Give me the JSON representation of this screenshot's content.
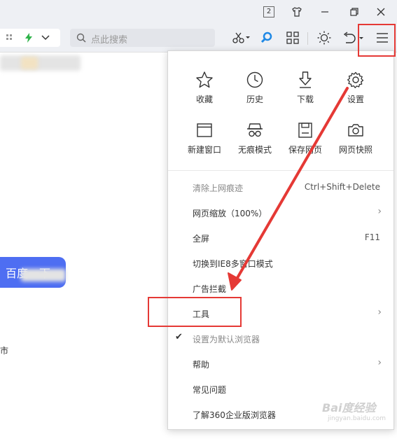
{
  "titlebar": {
    "tab_count": "2"
  },
  "toolbar": {
    "search_placeholder": "点此搜索"
  },
  "page": {
    "search_button": "百度一下",
    "fragment_text": "市"
  },
  "menu": {
    "grid": [
      {
        "label": "收藏",
        "icon": "star-icon"
      },
      {
        "label": "历史",
        "icon": "clock-icon"
      },
      {
        "label": "下载",
        "icon": "download-icon"
      },
      {
        "label": "设置",
        "icon": "gear-icon"
      },
      {
        "label": "新建窗口",
        "icon": "window-icon"
      },
      {
        "label": "无痕模式",
        "icon": "incognito-icon"
      },
      {
        "label": "保存网页",
        "icon": "save-icon"
      },
      {
        "label": "网页快照",
        "icon": "camera-icon"
      }
    ],
    "items": [
      {
        "label": "清除上网痕迹",
        "shortcut": "Ctrl+Shift+Delete"
      },
      {
        "label": "网页缩放（100%）",
        "arrow": "›"
      },
      {
        "label": "全屏",
        "shortcut": "F11"
      },
      {
        "label": "切换到IE8多窗口模式"
      },
      {
        "label": "广告拦截"
      },
      {
        "label": "工具",
        "arrow": "›"
      },
      {
        "label": "设置为默认浏览器",
        "check": "✔"
      },
      {
        "label": "帮助",
        "arrow": "›"
      },
      {
        "label": "常见问题"
      },
      {
        "label": "了解360企业版浏览器"
      }
    ]
  },
  "watermark": {
    "main": "Bai度经验",
    "sub": "jingyan.baidu.com"
  },
  "colors": {
    "highlight": "#e53935",
    "accent_blue": "#4e6ef2",
    "lightning_green": "#2fb34a",
    "search_icon_blue": "#1e88e5"
  }
}
